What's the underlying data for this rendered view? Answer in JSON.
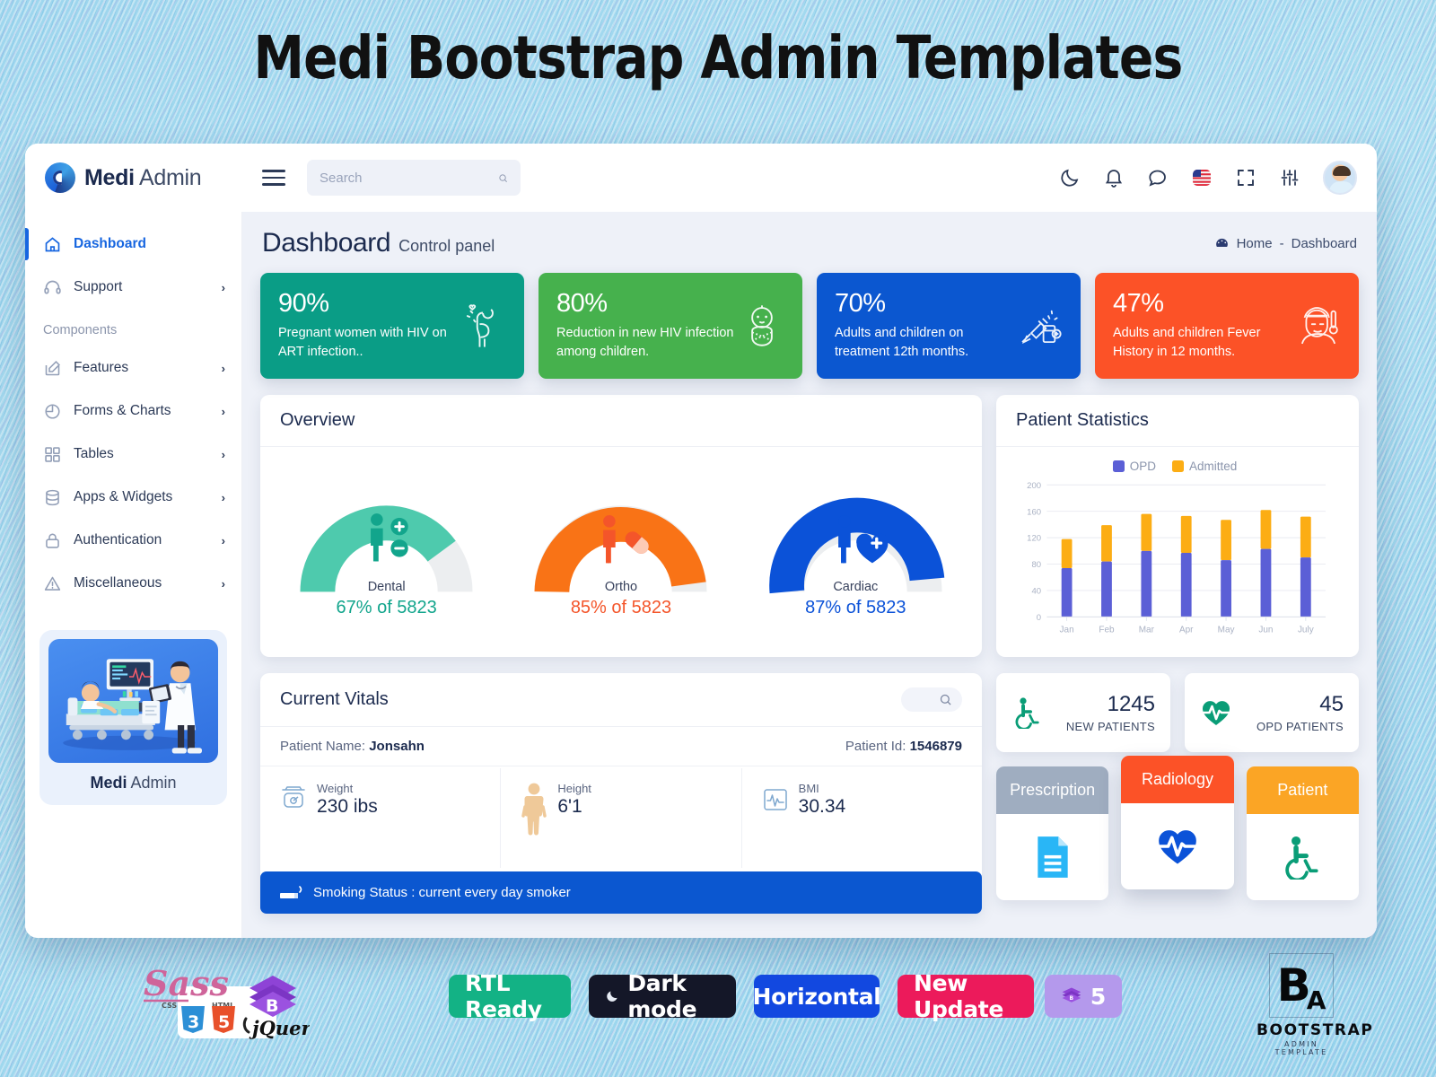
{
  "page_title": "Medi Bootstrap Admin Templates",
  "brand": {
    "bold": "Medi",
    "light": " Admin"
  },
  "search": {
    "placeholder": "Search",
    "value": ""
  },
  "topbar_icons": [
    {
      "name": "dark-mode-icon",
      "label": "Dark mode"
    },
    {
      "name": "notification-bell-icon",
      "label": "Notifications"
    },
    {
      "name": "chat-icon",
      "label": "Messages"
    },
    {
      "name": "flag-us-icon",
      "label": "Language"
    },
    {
      "name": "fullscreen-icon",
      "label": "Fullscreen"
    },
    {
      "name": "settings-sliders-icon",
      "label": "Settings"
    }
  ],
  "sidebar": {
    "items": [
      {
        "label": "Dashboard",
        "icon": "home-icon",
        "active": true,
        "chevron": false
      },
      {
        "label": "Support",
        "icon": "headset-icon",
        "active": false,
        "chevron": true
      }
    ],
    "section_label": "Components",
    "component_items": [
      {
        "label": "Features",
        "icon": "edit-square-icon",
        "chevron": true
      },
      {
        "label": "Forms & Charts",
        "icon": "pie-chart-icon",
        "chevron": true
      },
      {
        "label": "Tables",
        "icon": "grid-icon",
        "chevron": true
      },
      {
        "label": "Apps & Widgets",
        "icon": "database-icon",
        "chevron": true
      },
      {
        "label": "Authentication",
        "icon": "lock-icon",
        "chevron": true
      },
      {
        "label": "Miscellaneous",
        "icon": "warning-triangle-icon",
        "chevron": true
      }
    ],
    "promo": {
      "bold": "Medi",
      "light": " Admin"
    }
  },
  "page_head": {
    "title": "Dashboard",
    "subtitle": "Control panel",
    "breadcrumb_home": "Home",
    "breadcrumb_sep": "-",
    "breadcrumb_current": "Dashboard"
  },
  "stat_cards": [
    {
      "pct": "90%",
      "desc": "Pregnant women with HIV on ART infection..",
      "color": "#0a9d86",
      "icon": "pregnant-woman-icon"
    },
    {
      "pct": "80%",
      "desc": "Reduction in new HIV infection among children.",
      "color": "#46b14d",
      "icon": "baby-icon"
    },
    {
      "pct": "70%",
      "desc": "Adults and children on treatment 12th months.",
      "color": "#0b57d0",
      "icon": "syringe-icon"
    },
    {
      "pct": "47%",
      "desc": "Adults and children Fever History in 12 months.",
      "color": "#fc5227",
      "icon": "fever-patient-icon"
    }
  ],
  "overview": {
    "title": "Overview",
    "gauges": [
      {
        "label": "Dental",
        "value": "67% of 5823",
        "percent": 67,
        "color": "#4ecaad",
        "icon": "person-plus-minus-icon"
      },
      {
        "label": "Ortho",
        "value": "85% of 5823",
        "percent": 85,
        "color": "#f97316",
        "icon": "person-pill-icon"
      },
      {
        "label": "Cardiac",
        "value": "87% of 5823",
        "percent": 87,
        "color": "#0b52d8",
        "icon": "person-heart-icon"
      }
    ]
  },
  "patient_statistics": {
    "title": "Patient Statistics"
  },
  "chart_data": {
    "type": "bar",
    "title": "Patient Statistics",
    "stacked": true,
    "categories": [
      "Jan",
      "Feb",
      "Mar",
      "Apr",
      "May",
      "Jun",
      "July"
    ],
    "series": [
      {
        "name": "OPD",
        "color": "#5b5fd6",
        "values": [
          74,
          84,
          100,
          97,
          86,
          103,
          90
        ]
      },
      {
        "name": "Admitted",
        "color": "#fcad14",
        "values": [
          44,
          55,
          56,
          56,
          61,
          59,
          62
        ]
      }
    ],
    "totals": [
      118,
      139,
      156,
      153,
      147,
      162,
      152
    ],
    "yticks": [
      0,
      40,
      80,
      120,
      160,
      200
    ],
    "ylim": [
      0,
      200
    ],
    "xlabel": "",
    "ylabel": "",
    "grid": true,
    "legend_position": "top-center"
  },
  "vitals": {
    "title": "Current Vitals",
    "search_icon": "search-icon",
    "patient_name_label": "Patient Name:",
    "patient_name": "Jonsahn",
    "patient_id_label": "Patient Id:",
    "patient_id": "1546879",
    "cells": [
      {
        "name": "Weight",
        "value": "230 ibs",
        "icon": "weight-scale-icon"
      },
      {
        "name": "Height",
        "value": "6'1",
        "icon": "body-figure-icon"
      },
      {
        "name": "BMI",
        "value": "30.34",
        "icon": "ecg-monitor-icon"
      }
    ],
    "smoking_status": "Smoking Status : current every day smoker",
    "smoking_icon": "cigarette-icon"
  },
  "counters": [
    {
      "number": "1245",
      "label": "NEW PATIENTS",
      "icon": "wheelchair-icon",
      "color": "#0a9d77"
    },
    {
      "number": "45",
      "label": "OPD PATIENTS",
      "icon": "heart-pulse-icon",
      "color": "#0a9d77"
    }
  ],
  "tiles": [
    {
      "label": "Prescription",
      "head_color": "#9fadc0",
      "icon": "document-icon",
      "icon_color": "#29b6f6",
      "raised": false
    },
    {
      "label": "Radiology",
      "head_color": "#fc5227",
      "icon": "heart-pulse-icon",
      "icon_color": "#0b52d8",
      "raised": true
    },
    {
      "label": "Patient",
      "head_color": "#fba525",
      "icon": "wheelchair-icon",
      "icon_color": "#0a9d77",
      "raised": false
    }
  ],
  "bottom_badges": [
    {
      "label": "RTL Ready",
      "bg": "#13b285",
      "icon": null
    },
    {
      "label": "Dark mode",
      "bg": "#141728",
      "icon": "moon-icon"
    },
    {
      "label": "Horizontal",
      "bg": "#1248e0",
      "icon": null
    },
    {
      "label": "New Update",
      "bg": "#ec1a5b",
      "icon": null
    },
    {
      "label": "5",
      "bg": "#b499ec",
      "icon": "bootstrap-box-icon"
    }
  ],
  "tech_logos": [
    "Sass",
    "CSS3",
    "HTML5",
    "jQuery",
    "Bootstrap"
  ],
  "bootstrap_logo": {
    "mark": "B",
    "mark_sub": "A",
    "name": "BOOTSTRAP",
    "sub": "ADMIN TEMPLATE"
  }
}
